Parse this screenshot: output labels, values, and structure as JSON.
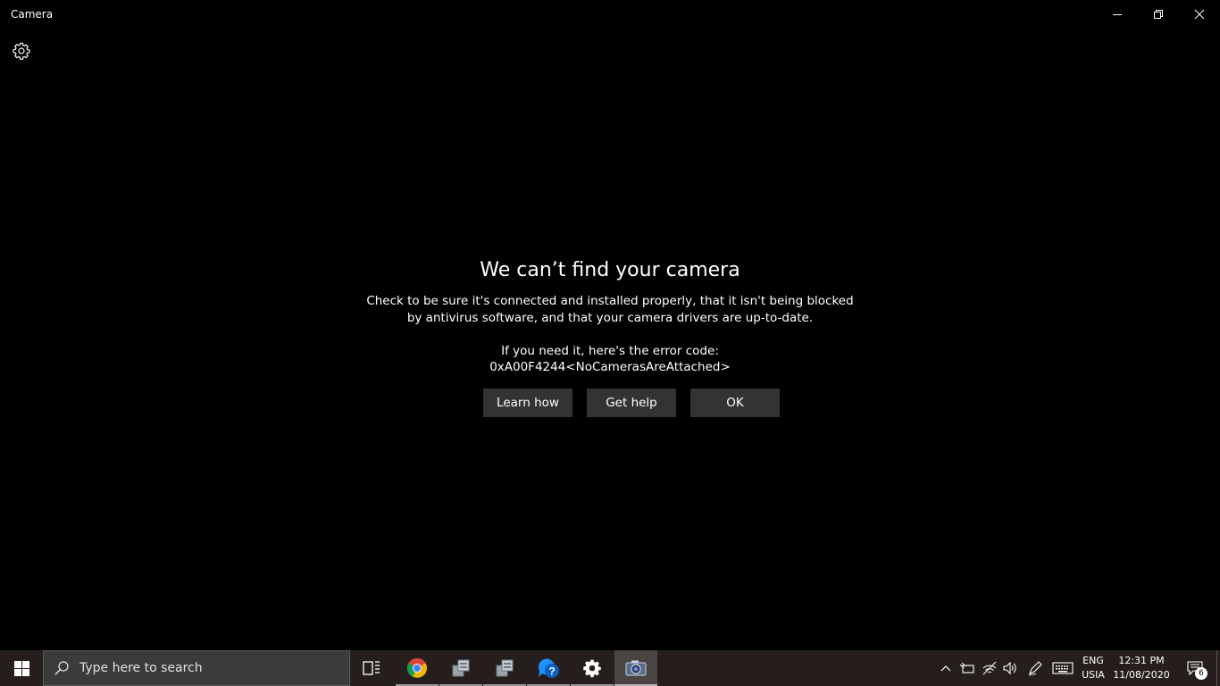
{
  "window": {
    "title": "Camera",
    "controls": {
      "minimize": "minimize-icon",
      "restore": "restore-icon",
      "close": "close-icon"
    }
  },
  "toolbar": {
    "settings_icon": "gear-icon"
  },
  "error": {
    "title": "We can’t find your camera",
    "description_line1": "Check to be sure it's connected and installed properly, that it isn't being blocked",
    "description_line2": "by antivirus software, and that your camera drivers are up-to-date.",
    "code_intro": "If you need it, here's the error code:",
    "code": "0xA00F4244<NoCamerasAreAttached>",
    "buttons": {
      "learn_how": "Learn how",
      "get_help": "Get help",
      "ok": "OK"
    }
  },
  "taskbar": {
    "search_placeholder": "Type here to search",
    "apps": [
      "task-view-icon",
      "chrome-icon",
      "app-icon",
      "app-icon",
      "get-help-icon",
      "settings-gear-icon",
      "camera-icon"
    ],
    "language": {
      "line1": "ENG",
      "line2": "USIA"
    },
    "clock": {
      "time": "12:31 PM",
      "date": "11/08/2020"
    },
    "notification_count": "6"
  },
  "colors": {
    "background": "#000000",
    "button": "#333333",
    "taskbar": "#261e1c",
    "search_box": "#3b3b3b"
  }
}
